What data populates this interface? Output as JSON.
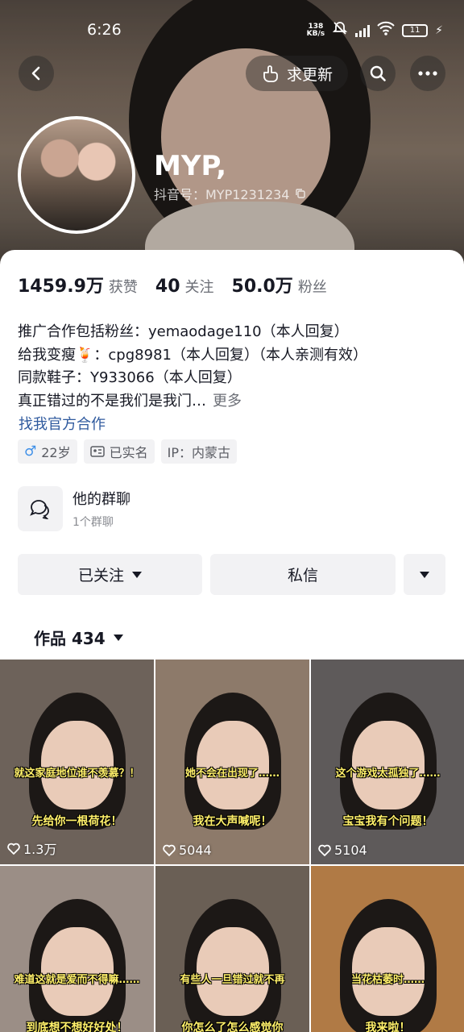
{
  "status_bar": {
    "time": "6:26",
    "net_speed_top": "138",
    "net_speed_bottom": "KB/s",
    "battery": "11"
  },
  "header": {
    "request_update_label": "求更新",
    "nickname": "MYP,",
    "douyin_id": "抖音号：MYP1231234"
  },
  "stats": [
    {
      "num": "1459.9万",
      "label": "获赞"
    },
    {
      "num": "40",
      "label": "关注"
    },
    {
      "num": "50.0万",
      "label": "粉丝"
    }
  ],
  "bio": {
    "lines": [
      "推广合作包括粉丝：yemaodage110（本人回复）",
      "给我变瘦🍹：cpg8981（本人回复）（本人亲测有效）",
      "同款鞋子：Y933066（本人回复）",
      "真正错过的不是我们是我门…"
    ],
    "more": "更多",
    "biz_link": "找我官方合作"
  },
  "tags": {
    "age": "22岁",
    "verified": "已实名",
    "ip": "IP：内蒙古"
  },
  "group_chat": {
    "title": "他的群聊",
    "subtitle": "1个群聊"
  },
  "actions": {
    "followed": "已关注",
    "message": "私信"
  },
  "works_tab": {
    "label": "作品 434"
  },
  "videos": [
    {
      "cap1": "就这家庭地位谁不羡慕？！",
      "cap2": "先给你一根荷花！",
      "likes": "1.3万",
      "bg": "#6d625a"
    },
    {
      "cap1": "她不会在出现了……",
      "cap2": "我在大声喊呢！",
      "likes": "5044",
      "bg": "#8d7a6a"
    },
    {
      "cap1": "这个游戏太孤独了……",
      "cap2": "宝宝我有个问题！",
      "likes": "5104",
      "bg": "#5e5a5a"
    },
    {
      "cap1": "难道这就是爱而不得嘛……",
      "cap2": "到底想不想好好处！",
      "likes": "",
      "bg": "#9b8e86"
    },
    {
      "cap1": "有些人一旦错过就不再",
      "cap2": "你怎么了怎么感觉你",
      "likes": "",
      "bg": "#6a5f55"
    },
    {
      "cap1": "当花枯萎时……",
      "cap2": "我来啦！",
      "likes": "",
      "bg": "#b07a45"
    }
  ]
}
